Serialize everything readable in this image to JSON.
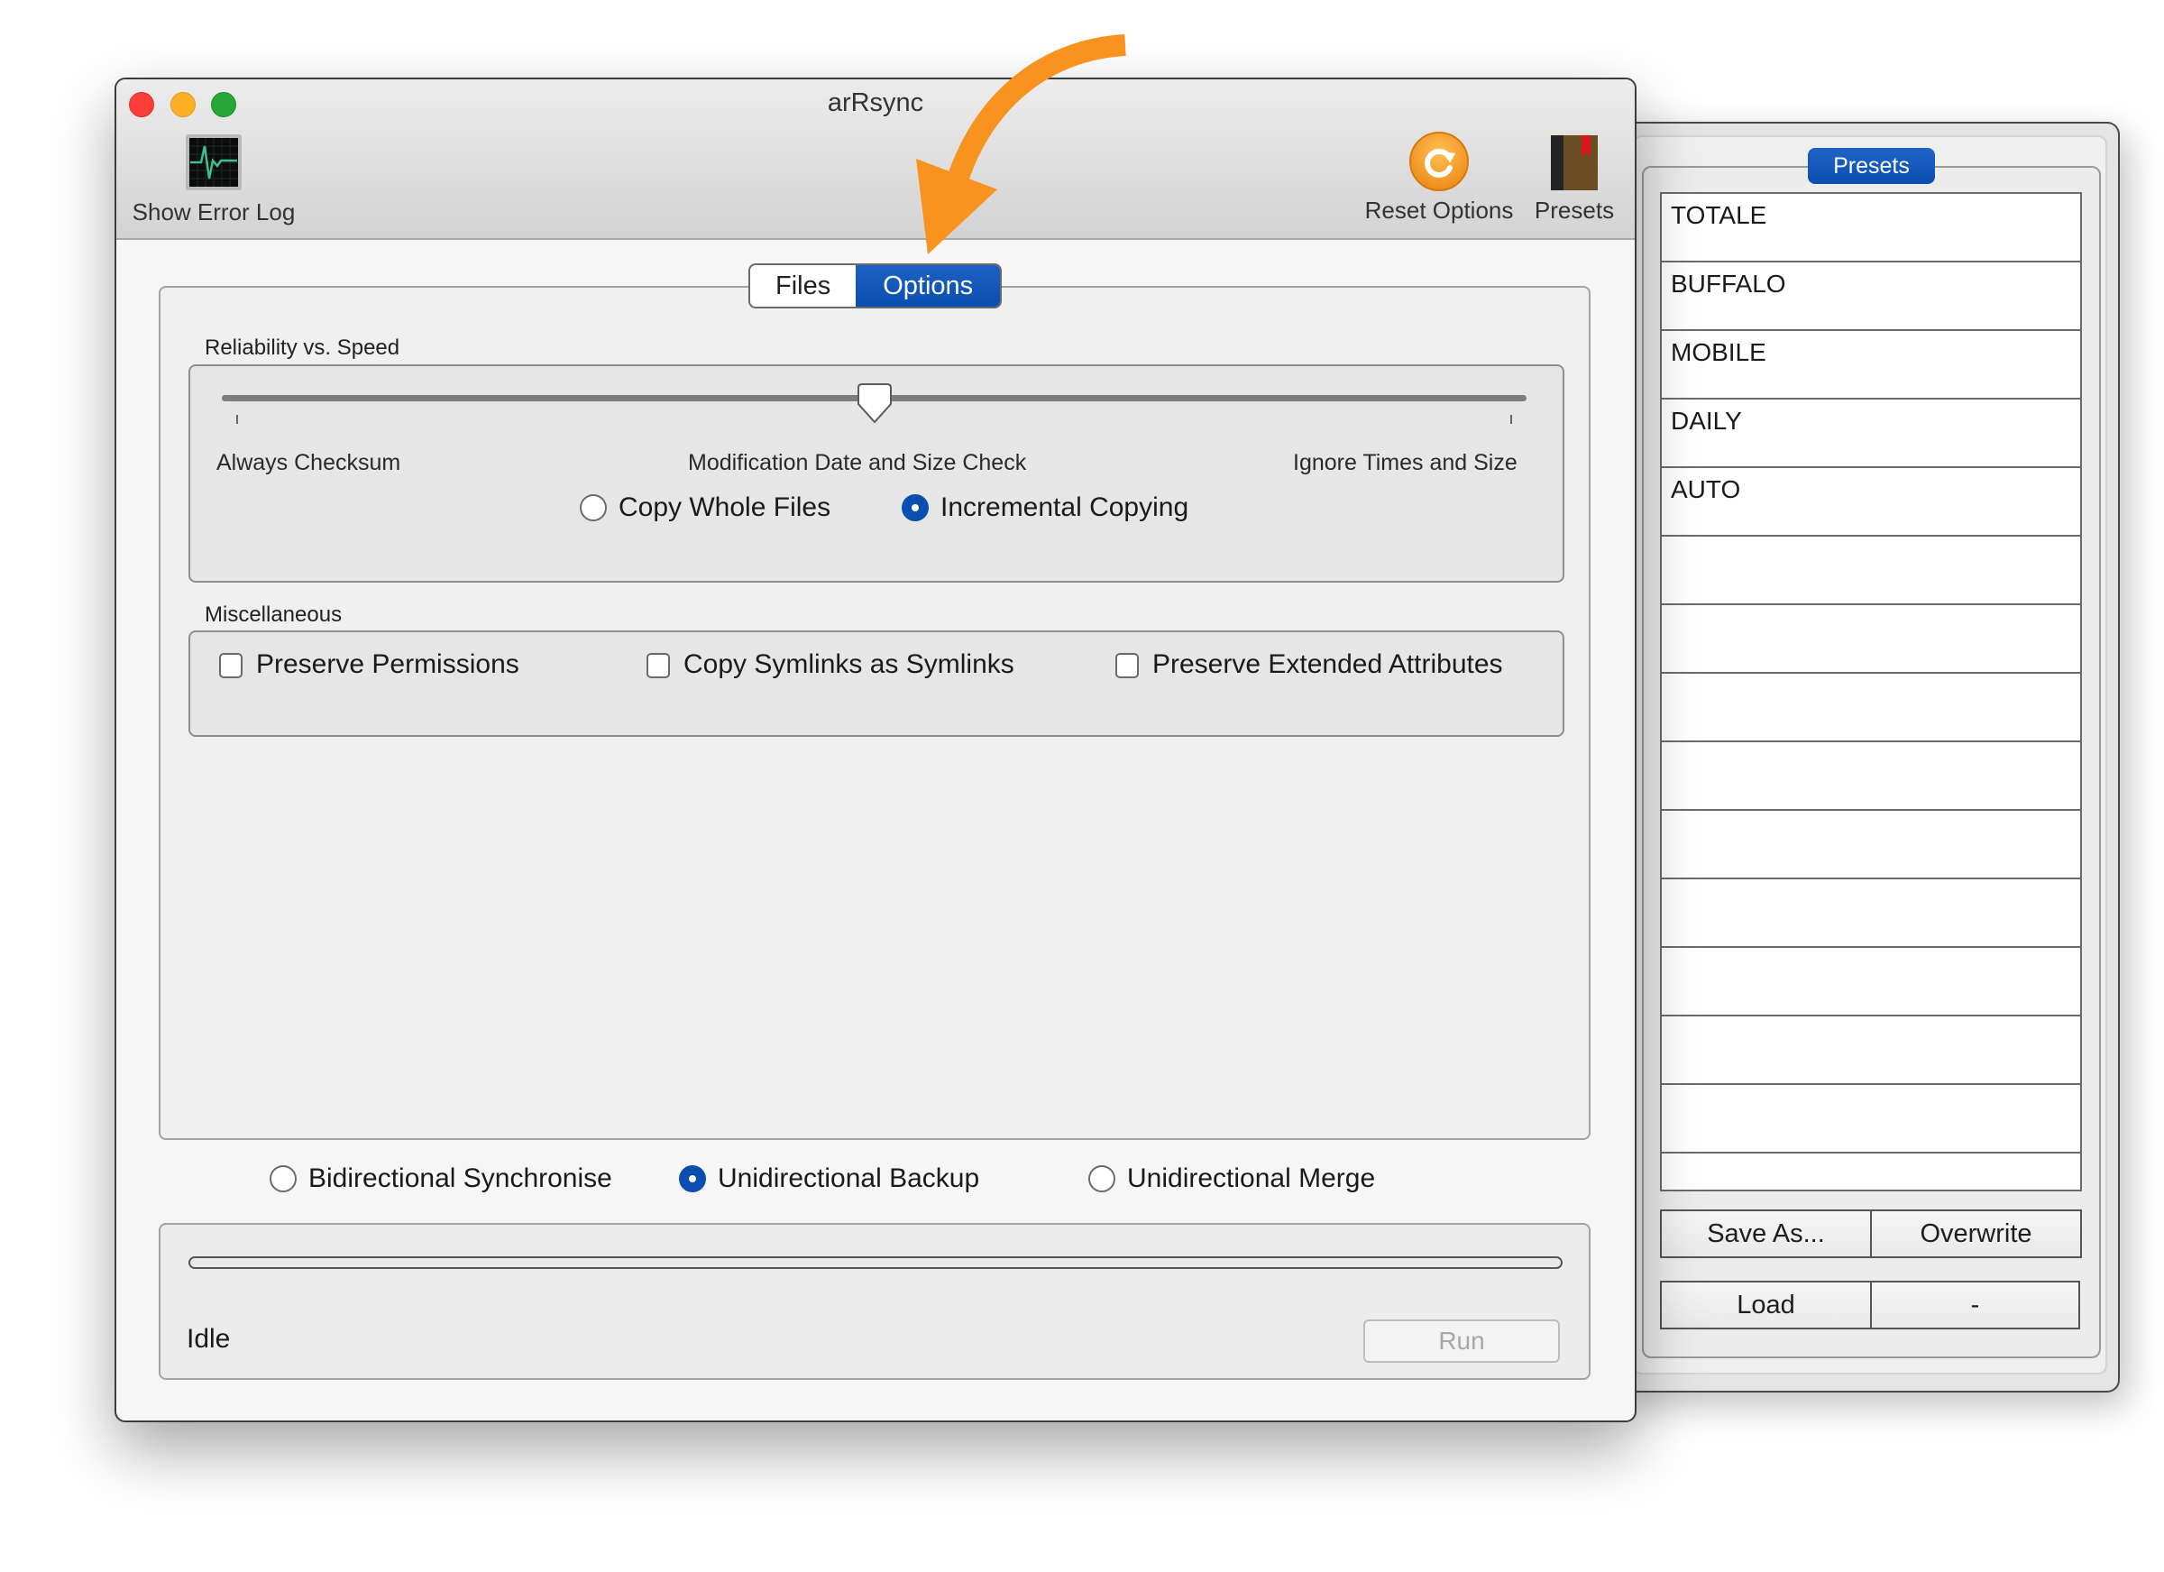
{
  "window": {
    "title": "arRsync"
  },
  "toolbar": {
    "show_error_log": {
      "label": "Show Error Log",
      "icon": "activity-monitor-icon"
    },
    "reset_options": {
      "label": "Reset Options",
      "icon": "reset-circular-arrow-icon"
    },
    "presets": {
      "label": "Presets",
      "icon": "book-bookmark-icon"
    }
  },
  "tabs": [
    {
      "label": "Files",
      "selected": false
    },
    {
      "label": "Options",
      "selected": true
    }
  ],
  "options": {
    "reliability": {
      "section_label": "Reliability vs. Speed",
      "slider": {
        "stops": [
          "Always Checksum",
          "Modification Date and Size Check",
          "Ignore Times and Size"
        ],
        "selected_index": 1,
        "value_fraction": 0.5
      },
      "copy_mode": {
        "options": [
          {
            "label": "Copy Whole Files",
            "selected": false
          },
          {
            "label": "Incremental Copying",
            "selected": true
          }
        ]
      }
    },
    "misc": {
      "section_label": "Miscellaneous",
      "checkboxes": [
        {
          "label": "Preserve Permissions",
          "checked": false
        },
        {
          "label": "Copy Symlinks as Symlinks",
          "checked": false
        },
        {
          "label": "Preserve Extended Attributes",
          "checked": false
        }
      ]
    }
  },
  "sync_mode": {
    "options": [
      {
        "label": "Bidirectional Synchronise",
        "selected": false
      },
      {
        "label": "Unidirectional Backup",
        "selected": true
      },
      {
        "label": "Unidirectional Merge",
        "selected": false
      }
    ]
  },
  "status": {
    "text": "Idle",
    "progress": 0,
    "run_label": "Run",
    "run_enabled": false
  },
  "presets_drawer": {
    "title": "Presets",
    "items": [
      "TOTALE",
      "BUFFALO",
      "MOBILE",
      "DAILY",
      "AUTO",
      "",
      "",
      "",
      "",
      "",
      "",
      "",
      "",
      ""
    ],
    "buttons": {
      "save_as": "Save As...",
      "overwrite": "Overwrite",
      "load": "Load",
      "remove": "-"
    }
  },
  "colors": {
    "accent": "#0A4FB0",
    "annotation_arrow": "#F7931E",
    "traffic_close": "#FC3D39",
    "traffic_minimize": "#FDB024",
    "traffic_zoom": "#27A538"
  }
}
